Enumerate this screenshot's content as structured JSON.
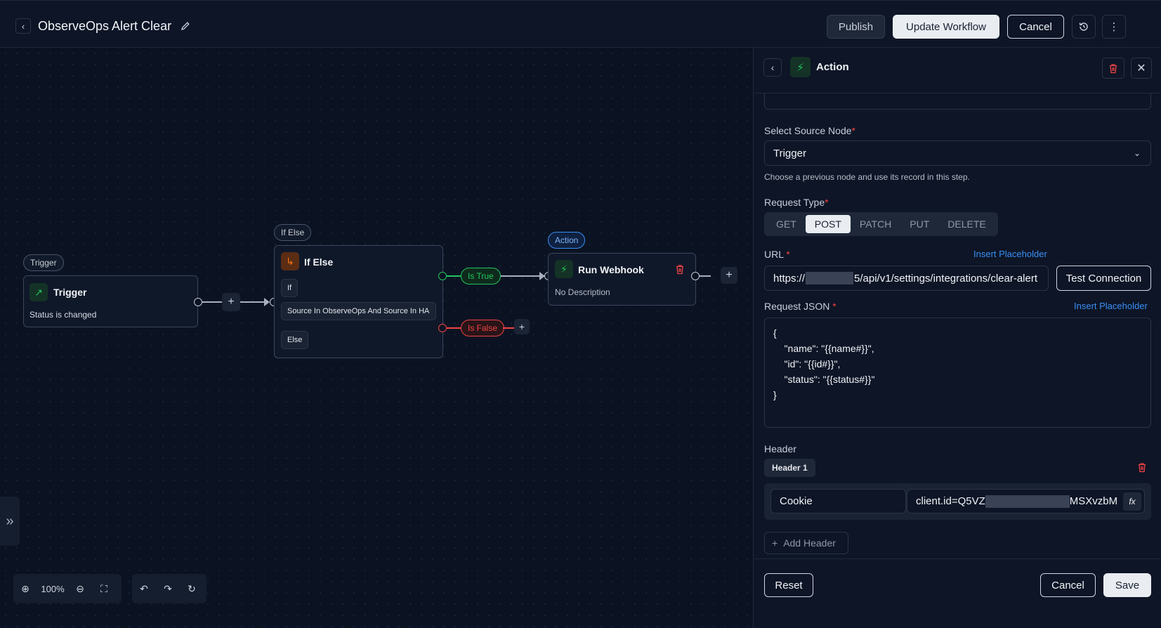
{
  "header": {
    "title": "ObserveOps Alert Clear",
    "publish_label": "Publish",
    "update_label": "Update Workflow",
    "cancel_label": "Cancel"
  },
  "canvas": {
    "trigger_node": {
      "badge": "Trigger",
      "title": "Trigger",
      "subtitle": "Status is changed"
    },
    "ifelse_node": {
      "badge": "If Else",
      "title": "If Else",
      "if_label": "If",
      "condition": "Source In ObserveOps And Source In HA",
      "else_label": "Else",
      "true_label": "Is True",
      "false_label": "Is False"
    },
    "action_node": {
      "badge": "Action",
      "title": "Run Webhook",
      "subtitle": "No Description"
    },
    "zoom": "100%"
  },
  "panel": {
    "title": "Action",
    "source_node_label": "Select Source Node",
    "source_node_value": "Trigger",
    "source_node_help": "Choose a previous node and use its record in this step.",
    "request_type_label": "Request Type",
    "request_types": [
      "GET",
      "POST",
      "PATCH",
      "PUT",
      "DELETE"
    ],
    "request_type_selected": "POST",
    "url_label": "URL",
    "insert_placeholder": "Insert Placeholder",
    "url_prefix": "https://",
    "url_suffix": "5/api/v1/settings/integrations/clear-alert",
    "test_connection": "Test Connection",
    "request_json_label": "Request JSON",
    "request_json": "{\n    \"name\": \"{{name#}}\",\n    \"id\": \"{{id#}}\",\n    \"status\": \"{{status#}}\"\n}",
    "header_label": "Header",
    "header_chip": "Header 1",
    "header_key": "Cookie",
    "header_value_prefix": "client.id=Q5VZ",
    "header_value_suffix": "MSXvzbM",
    "fx_label": "fx",
    "add_header": "Add Header",
    "reset": "Reset",
    "cancel": "Cancel",
    "save": "Save"
  },
  "colors": {
    "accent_blue": "#3b8ff5",
    "true_green": "#22c55e",
    "false_red": "#ef4444",
    "action_green": "#22c55e",
    "ifelse_orange": "#f97316"
  }
}
